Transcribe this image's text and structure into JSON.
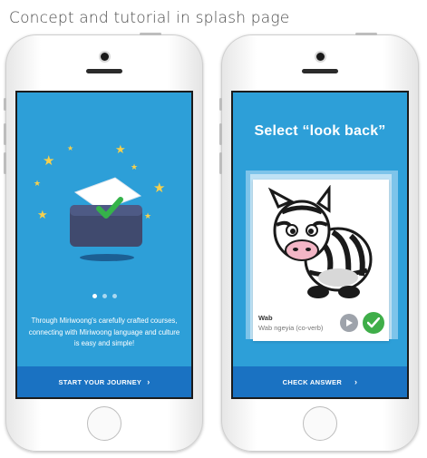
{
  "caption": "Concept and tutorial in splash page",
  "phone_left": {
    "description_text": "Through Miriwoong's carefully crafted courses, connecting with Miriwoong language and culture is easy and simple!",
    "pagination": {
      "total": 3,
      "active": 1
    },
    "cta_label": "START YOUR JOURNEY",
    "cta_chevron": "›"
  },
  "phone_right": {
    "title": "Select “look back”",
    "card": {
      "word": "Wab",
      "translation": "Wab ngeyia (co-verb)"
    },
    "cta_label": "CHECK ANSWER",
    "cta_chevron": "›"
  },
  "colors": {
    "screen_blue": "#2d9fd8",
    "button_blue": "#1a72c2",
    "star_yellow": "#f6d04d",
    "check_green": "#3fae49",
    "play_gray": "#9ea3ab"
  },
  "icons": [
    "star-icon",
    "folder-check-icon",
    "zebra-illustration",
    "play-icon",
    "checkmark-icon",
    "chevron-right-icon"
  ]
}
